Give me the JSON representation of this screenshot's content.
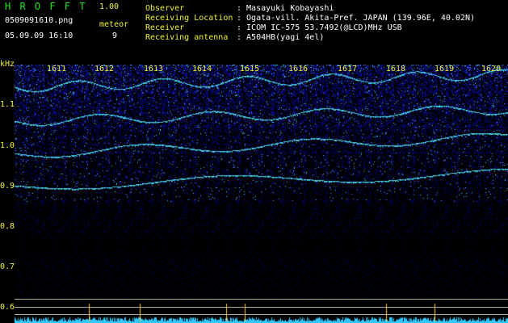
{
  "header": {
    "app_letters": "H R O F F T",
    "version": "1.00",
    "filename": "0509091610.png",
    "datetime": "05.09.09 16:10",
    "meteor_label": "meteor",
    "meteor_count": "9",
    "fields": [
      {
        "label": "Observer",
        "value": ": Masayuki Kobayashi"
      },
      {
        "label": "Receiving Location",
        "value": ": Ogata-vill. Akita-Pref. JAPAN (139.96E, 40.02N)"
      },
      {
        "label": "Receiver",
        "value": ": ICOM IC-575 53.7492(@LCD)MHz USB"
      },
      {
        "label": "Receiving antenna",
        "value": ": A504HB(yagi 4el)"
      }
    ]
  },
  "axis": {
    "y_unit": "kHz",
    "y_ticks": [
      "1.1",
      "1.0",
      "0.9",
      "0.8",
      "0.7",
      "0.6"
    ],
    "x_ticks": [
      "1611",
      "1612",
      "1613",
      "1614",
      "1615",
      "1616",
      "1617",
      "1618",
      "1619",
      "1620"
    ]
  },
  "colors": {
    "background": "#000000",
    "header_green": "#1ee21e",
    "header_yellow": "#f2f23a",
    "spectrum_blue": "#1b2bd6",
    "spectrum_cyan": "#35e0ff",
    "baseline_line": "#b5b08a"
  }
}
